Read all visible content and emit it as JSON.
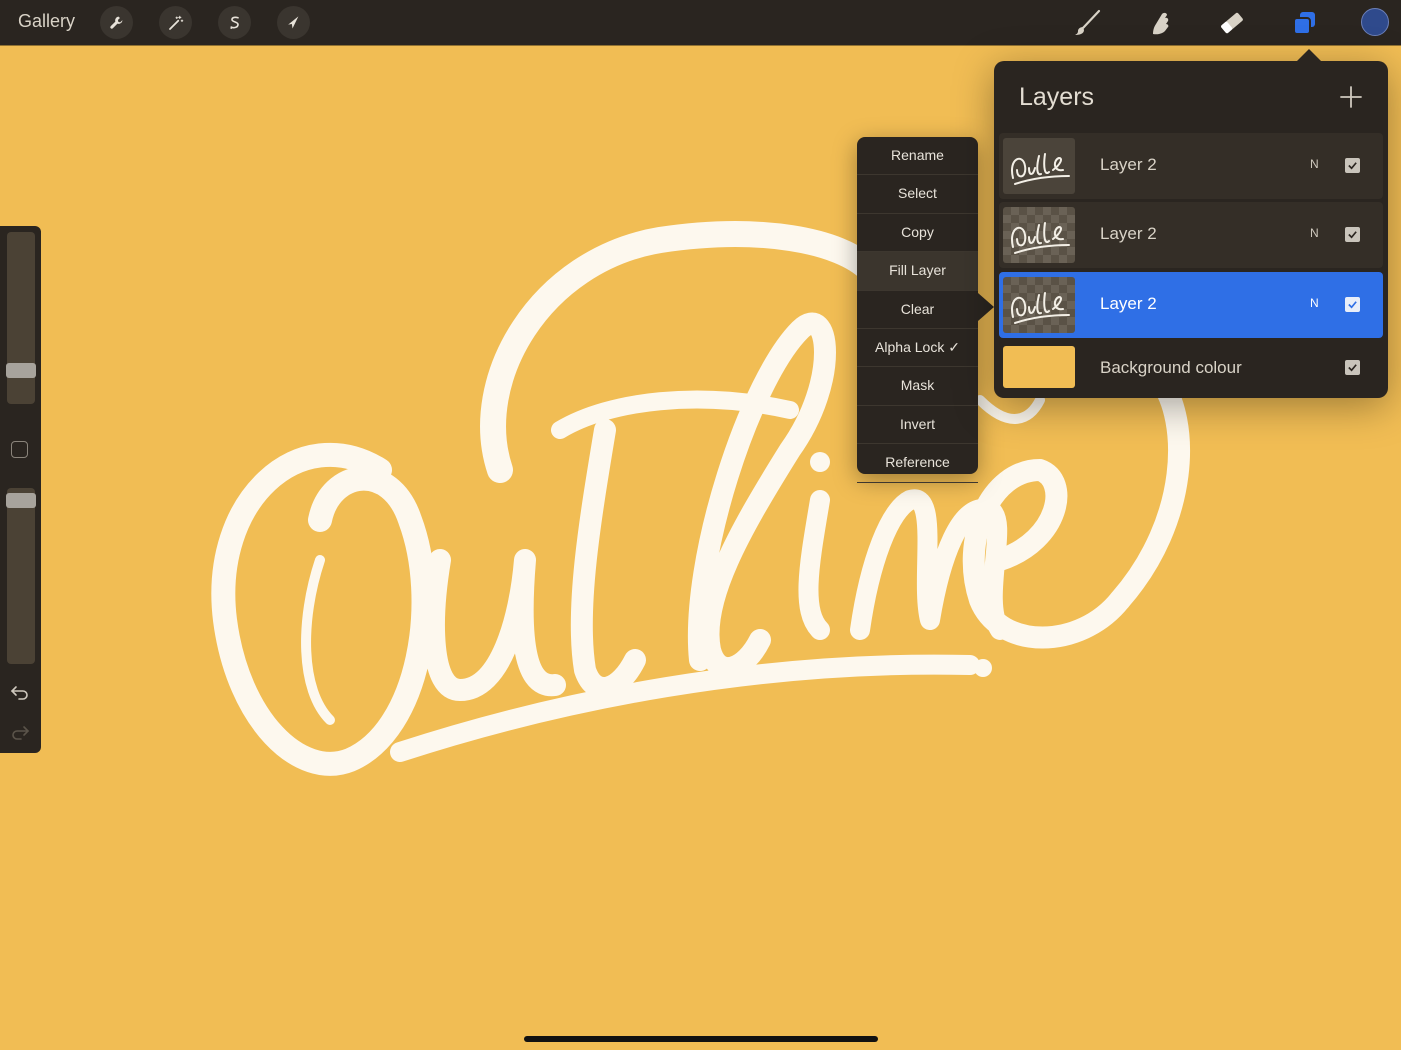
{
  "toolbar": {
    "gallery_label": "Gallery",
    "left_tools": [
      "wrench-icon",
      "magic-wand-icon",
      "selection-s-icon",
      "arrow-cursor-icon"
    ],
    "right_tools": [
      "brush-icon",
      "smudge-icon",
      "eraser-icon",
      "layers-icon"
    ],
    "active_color": "#2f4a8c"
  },
  "canvas": {
    "background_color": "#f1bd54",
    "lettering_color": "#fdf8ee"
  },
  "context_menu": {
    "items": [
      "Rename",
      "Select",
      "Copy",
      "Fill Layer",
      "Clear",
      "Alpha Lock ✓",
      "Mask",
      "Invert",
      "Reference"
    ],
    "highlighted_item": "Fill Layer"
  },
  "layers_panel": {
    "title": "Layers",
    "layers": [
      {
        "name": "Layer 2",
        "blend": "N",
        "visible": true,
        "selected": false
      },
      {
        "name": "Layer 2",
        "blend": "N",
        "visible": true,
        "selected": false
      },
      {
        "name": "Layer 2",
        "blend": "N",
        "visible": true,
        "selected": true
      },
      {
        "name": "Background colour",
        "blend": "",
        "visible": true,
        "selected": false
      }
    ],
    "accent_color": "#2f6fe6"
  }
}
